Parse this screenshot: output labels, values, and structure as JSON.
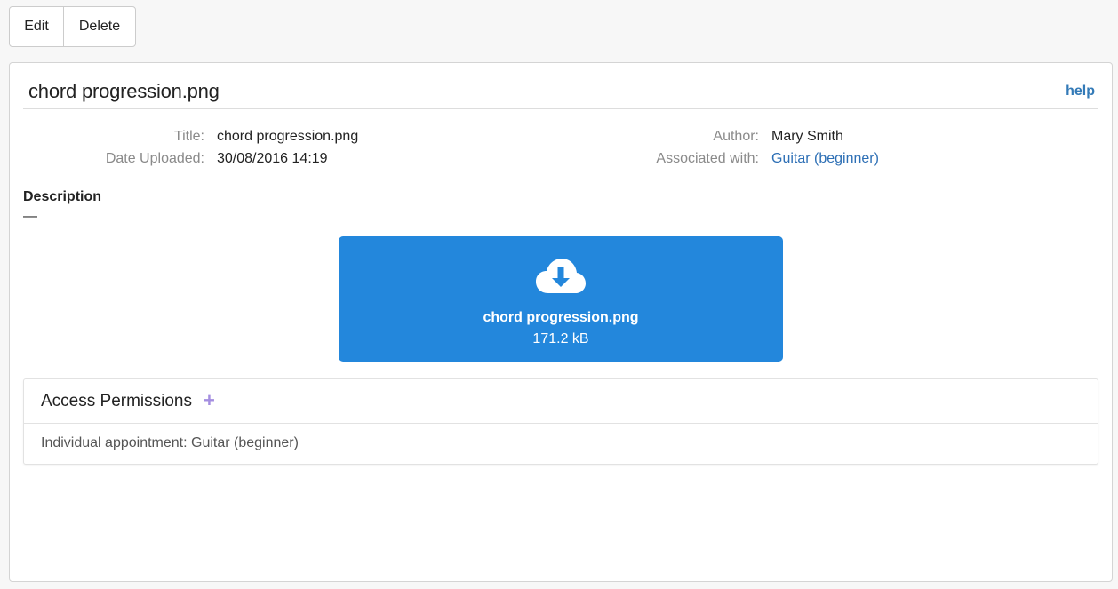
{
  "toolbar": {
    "edit_label": "Edit",
    "delete_label": "Delete"
  },
  "header": {
    "title": "chord progression.png",
    "help_label": "help"
  },
  "meta": {
    "title_label": "Title:",
    "title_value": "chord progression.png",
    "date_label": "Date Uploaded:",
    "date_value": "30/08/2016 14:19",
    "author_label": "Author:",
    "author_value": "Mary Smith",
    "associated_label": "Associated with:",
    "associated_value": "Guitar (beginner)"
  },
  "description": {
    "heading": "Description",
    "value": "—"
  },
  "download": {
    "icon": "cloud-download-icon",
    "filename": "chord progression.png",
    "size": "171.2 kB"
  },
  "permissions": {
    "title": "Access Permissions",
    "add_symbol": "+",
    "items": [
      "Individual appointment: Guitar (beginner)"
    ]
  },
  "colors": {
    "page_background": "#f7f7f7",
    "download_box": "#2387dc",
    "link": "#337ab7",
    "add_icon": "#a48ee0"
  }
}
